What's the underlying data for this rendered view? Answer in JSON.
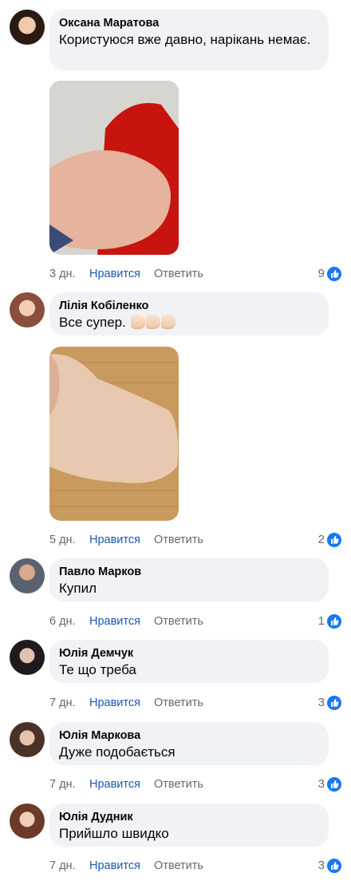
{
  "comments": [
    {
      "name": "Оксана Маратова",
      "text": "Користуюся вже давно, нарікань немає.",
      "time": "3 дн.",
      "like": "Нравится",
      "reply": "Ответить",
      "reactions": "9",
      "has_photo": true
    },
    {
      "name": "Лілія Кобіленко",
      "text": "Все супер.",
      "time": "5 дн.",
      "like": "Нравится",
      "reply": "Ответить",
      "reactions": "2",
      "has_photo": true,
      "emoji": "thumbs-up x3"
    },
    {
      "name": "Павло Марков",
      "text": "Купил",
      "time": "6 дн.",
      "like": "Нравится",
      "reply": "Ответить",
      "reactions": "1"
    },
    {
      "name": "Юлія Демчук",
      "text": "Те що треба",
      "time": "7 дн.",
      "like": "Нравится",
      "reply": "Ответить",
      "reactions": "3"
    },
    {
      "name": "Юлія Маркова",
      "text": "Дуже подобається",
      "time": "7 дн.",
      "like": "Нравится",
      "reply": "Ответить",
      "reactions": "3"
    },
    {
      "name": "Юлія Дудник",
      "text": "Прийшло швидко",
      "time": "7 дн.",
      "like": "Нравится",
      "reply": "Ответить",
      "reactions": "3"
    }
  ],
  "colors": {
    "bubble": "#f0f2f5",
    "link": "#1a57b5",
    "meta": "#65676b",
    "like_badge": "#1877f2"
  }
}
